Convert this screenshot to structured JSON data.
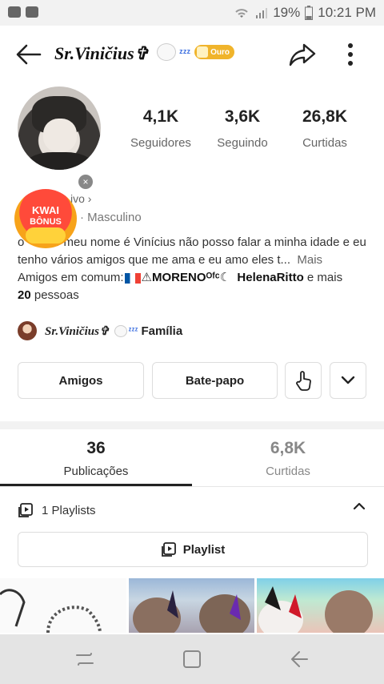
{
  "status_bar": {
    "battery": "19%",
    "time": "10:21 PM"
  },
  "header": {
    "title": "Sr.Viničius✞",
    "zz": "ᶻᶻᶻ",
    "badge": "Ouro"
  },
  "stats": [
    {
      "value": "4,1K",
      "label": "Seguidores"
    },
    {
      "value": "3,6K",
      "label": "Seguindo"
    },
    {
      "value": "26,8K",
      "label": "Curtidas"
    }
  ],
  "promo": {
    "line1": "KWAI",
    "line2": "BÔNUS",
    "close": "×"
  },
  "profile": {
    "active": "ivo ›",
    "gender": "· Masculino",
    "bio_start": "o",
    "bio_mid": "r meu nome é Vinícius não posso falar a minha idade e eu tenho vários amigos que me ama e eu amo eles t...",
    "bio_more": "Mais",
    "mutual_prefix": "Amigos em comum:",
    "mutual_friend1": "MORENOᴼᶠᶜ",
    "mutual_friend2": "HelenaRitto",
    "mutual_and": "e mais",
    "mutual_count": "20",
    "mutual_suffix": "pessoas"
  },
  "family": {
    "name": "Sr.Viničius✞",
    "zz": "ᶻᶻᶻ",
    "label": "Família"
  },
  "actions": {
    "friends": "Amigos",
    "chat": "Bate-papo"
  },
  "tabs": [
    {
      "value": "36",
      "label": "Publicações"
    },
    {
      "value": "6,8K",
      "label": "Curtidas"
    }
  ],
  "playlists": {
    "count_label": "1 Playlists",
    "button": "Playlist"
  },
  "colors": {
    "accent_gold": "#f0b42b",
    "promo_red": "#ff4a3a",
    "zz_blue": "#3a6ee0"
  }
}
